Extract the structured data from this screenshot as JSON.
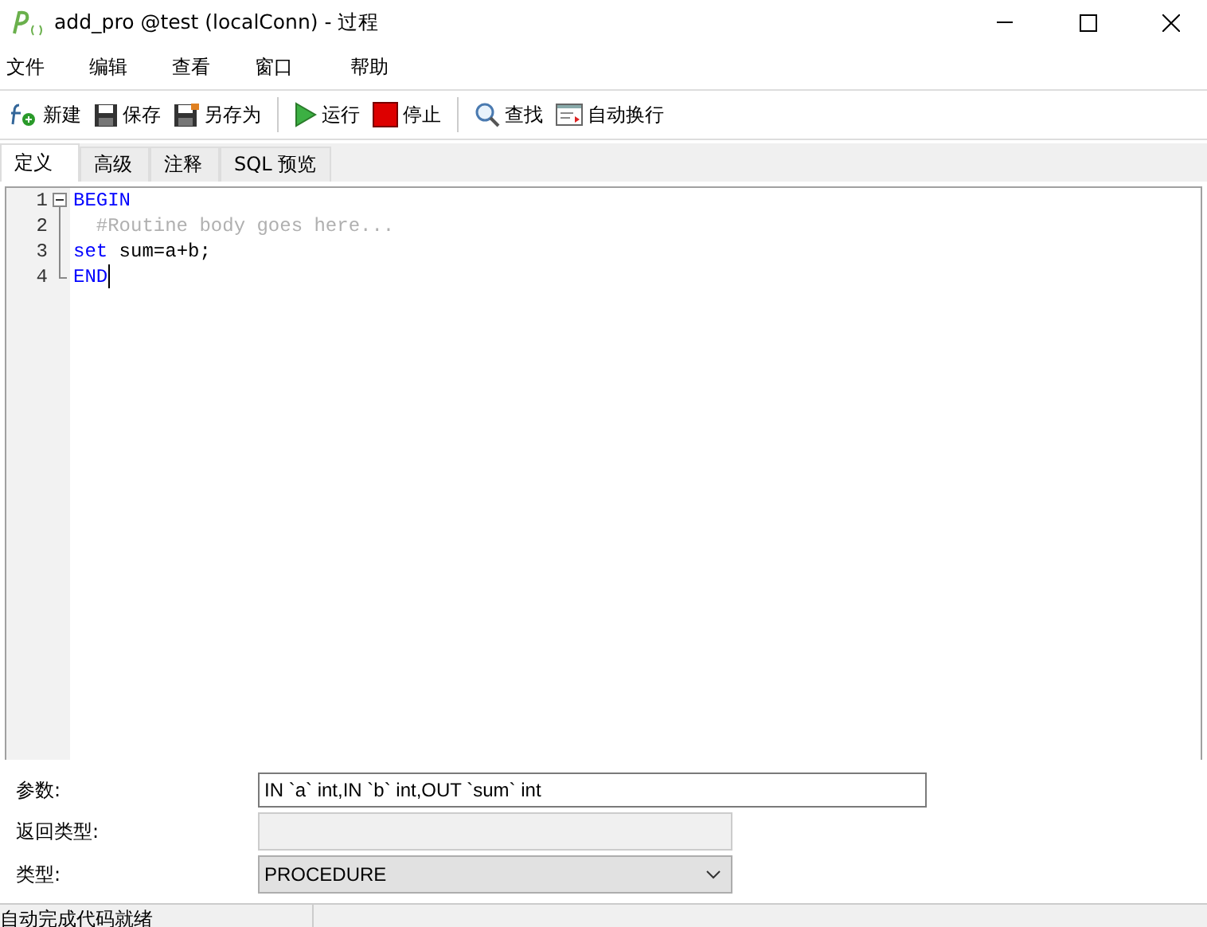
{
  "window": {
    "title": "add_pro @test (localConn) - 过程"
  },
  "menu": [
    "文件",
    "编辑",
    "查看",
    "窗口",
    "帮助"
  ],
  "toolbar": [
    {
      "kind": "new",
      "label": "新建"
    },
    {
      "kind": "save",
      "label": "保存"
    },
    {
      "kind": "saveas",
      "label": "另存为"
    },
    {
      "kind": "sep"
    },
    {
      "kind": "run",
      "label": "运行"
    },
    {
      "kind": "stop",
      "label": "停止"
    },
    {
      "kind": "sep"
    },
    {
      "kind": "find",
      "label": "查找"
    },
    {
      "kind": "wrap",
      "label": "自动换行"
    }
  ],
  "tabs": [
    {
      "label": "定义",
      "selected": true
    },
    {
      "label": "高级",
      "selected": false
    },
    {
      "label": "注释",
      "selected": false
    },
    {
      "label": "SQL 预览",
      "selected": false
    }
  ],
  "editor": {
    "lines": [
      {
        "number": "1",
        "tokens": [
          {
            "text": "BEGIN",
            "kind": "keyword"
          }
        ]
      },
      {
        "number": "2",
        "tokens": [
          {
            "text": "  #Routine body goes here...",
            "kind": "comment"
          }
        ]
      },
      {
        "number": "3",
        "tokens": [
          {
            "text": "set",
            "kind": "keyword"
          },
          {
            "text": " sum=a+b;",
            "kind": "plain"
          }
        ]
      },
      {
        "number": "4",
        "tokens": [
          {
            "text": "END",
            "kind": "keyword"
          }
        ]
      }
    ]
  },
  "form": [
    {
      "kind": "input",
      "label": "参数:",
      "value": "IN `a` int,IN `b` int,OUT `sum` int"
    },
    {
      "kind": "disabled",
      "label": "返回类型:"
    },
    {
      "kind": "select",
      "label": "类型:",
      "value": "PROCEDURE"
    }
  ],
  "status_bar": {
    "text": "自动完成代码就绪"
  }
}
